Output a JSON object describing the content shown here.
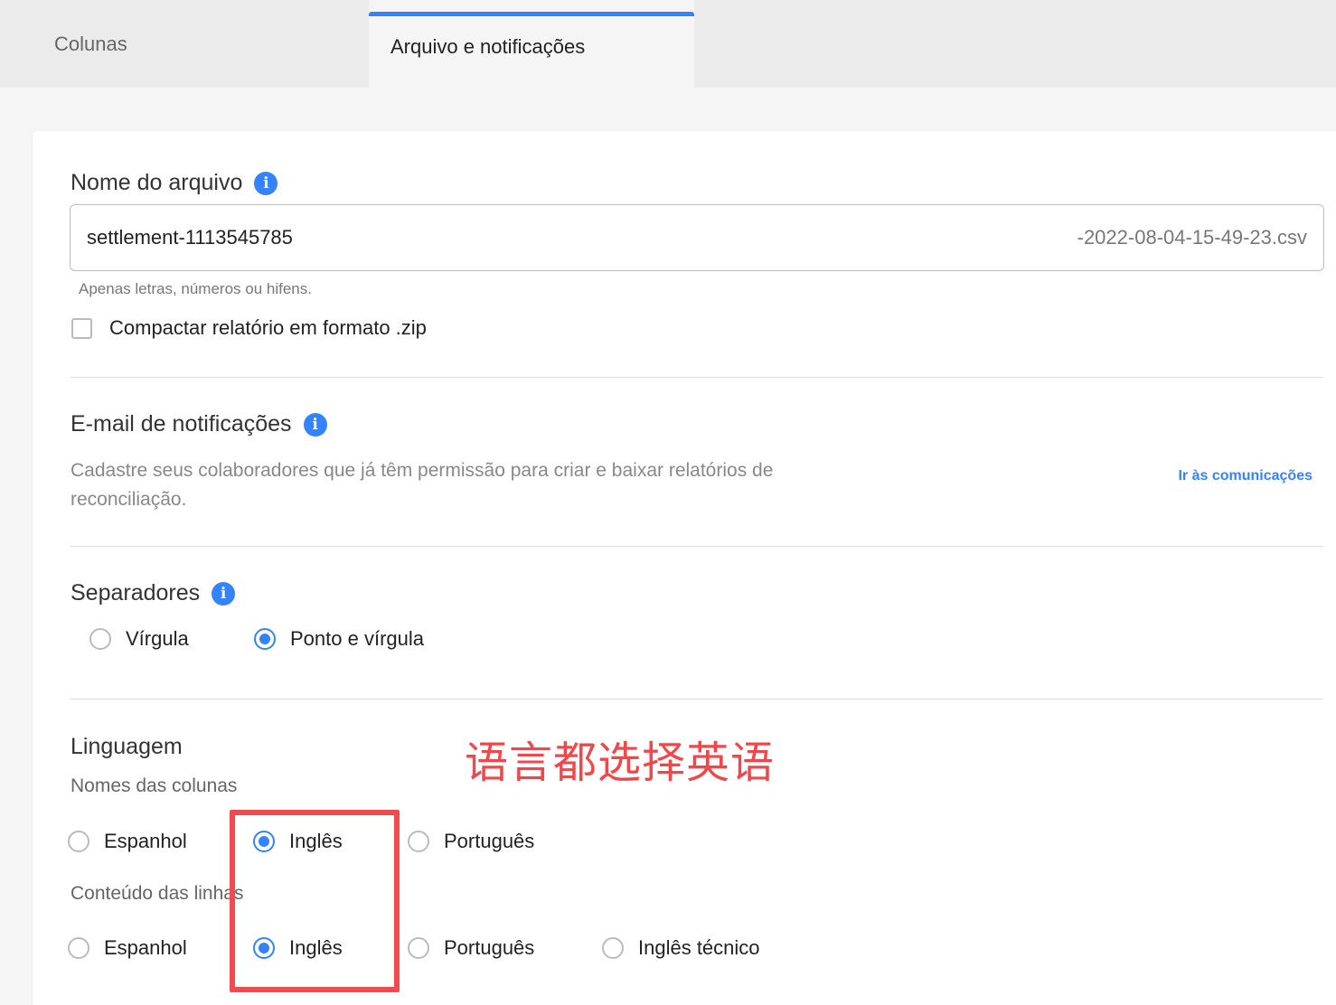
{
  "tabs": {
    "colunas": "Colunas",
    "arquivo": "Arquivo e notificações"
  },
  "file_name": {
    "title": "Nome do arquivo",
    "value": "settlement-1113545785",
    "suffix": "-2022-08-04-15-49-23.csv",
    "helper": "Apenas letras, números ou hifens.",
    "zip_label": "Compactar relatório em formato .zip",
    "zip_checked": false
  },
  "email": {
    "title": "E-mail de notificações",
    "description": "Cadastre seus colaboradores que já têm permissão para criar e baixar relatórios de reconciliação.",
    "link": "Ir às comunicações"
  },
  "separators": {
    "title": "Separadores",
    "options": [
      "Vírgula",
      "Ponto e vírgula"
    ],
    "selected": "Ponto e vírgula"
  },
  "language": {
    "title": "Linguagem",
    "column_names_label": "Nomes das colunas",
    "column_names_options": [
      "Espanhol",
      "Inglês",
      "Português"
    ],
    "column_names_selected": "Inglês",
    "row_content_label": "Conteúdo das linhas",
    "row_content_options": [
      "Espanhol",
      "Inglês",
      "Português",
      "Inglês técnico"
    ],
    "row_content_selected": "Inglês"
  },
  "annotation": "语言都选择英语",
  "colors": {
    "accent": "#3483fa",
    "annotation": "#f24a4f"
  },
  "icons": [
    "info-icon"
  ]
}
